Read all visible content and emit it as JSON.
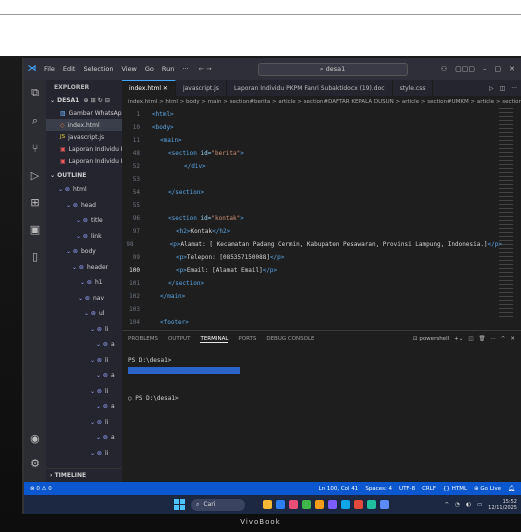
{
  "titlebar": {
    "menus": [
      "File",
      "Edit",
      "Selection",
      "View",
      "Go",
      "Run",
      "···"
    ],
    "nav": "← →",
    "search": "desa1"
  },
  "sidebar": {
    "header": "EXPLORER",
    "folder": "DESA1",
    "files": [
      {
        "name": "Gambar WhatsApp 2...",
        "type": "img"
      },
      {
        "name": "index.html",
        "type": "html"
      },
      {
        "name": "javascript.js",
        "type": "js"
      },
      {
        "name": "Laporan Individu PKP...",
        "type": "pdf"
      },
      {
        "name": "Laporan Individu PKP...",
        "type": "pdf"
      }
    ],
    "outline_label": "OUTLINE",
    "outline": [
      {
        "label": "html",
        "indent": 12
      },
      {
        "label": "head",
        "indent": 20
      },
      {
        "label": "title",
        "indent": 30
      },
      {
        "label": "link",
        "indent": 30
      },
      {
        "label": "body",
        "indent": 20
      },
      {
        "label": "header",
        "indent": 26
      },
      {
        "label": "h1",
        "indent": 34
      },
      {
        "label": "nav",
        "indent": 32
      },
      {
        "label": "ul",
        "indent": 38
      },
      {
        "label": "li",
        "indent": 44
      },
      {
        "label": "a",
        "indent": 50
      },
      {
        "label": "li",
        "indent": 44
      },
      {
        "label": "a",
        "indent": 50
      },
      {
        "label": "li",
        "indent": 44
      },
      {
        "label": "a",
        "indent": 50
      },
      {
        "label": "li",
        "indent": 44
      },
      {
        "label": "a",
        "indent": 50
      },
      {
        "label": "li",
        "indent": 44
      }
    ],
    "timeline_label": "TIMELINE"
  },
  "tabs": [
    {
      "label": "index.html ✕",
      "active": true
    },
    {
      "label": "javascript.js",
      "active": false
    },
    {
      "label": "Laporan Individu PKPM Fanri Subaktidocx (19).doc",
      "active": false
    },
    {
      "label": "style.css",
      "active": false
    }
  ],
  "breadcrumb": "index.html > html > body > main > section#berita > article > section#DAFTAR KEPALA DUSUN > article > section#UMKM > article > section#ko",
  "code_lines": [
    {
      "n": "1",
      "indent": 0,
      "parts": [
        {
          "c": "tag",
          "t": "<html>"
        }
      ]
    },
    {
      "n": "10",
      "indent": 0,
      "parts": [
        {
          "c": "tag",
          "t": "<body>"
        }
      ]
    },
    {
      "n": "11",
      "indent": 2,
      "parts": [
        {
          "c": "tag",
          "t": "<main>"
        }
      ]
    },
    {
      "n": "48",
      "indent": 4,
      "parts": [
        {
          "c": "tag",
          "t": "<section "
        },
        {
          "c": "attr",
          "t": "id="
        },
        {
          "c": "str",
          "t": "\"berita\""
        },
        {
          "c": "tag",
          "t": ">"
        }
      ]
    },
    {
      "n": "52",
      "indent": 8,
      "parts": [
        {
          "c": "tag",
          "t": "</div>"
        }
      ]
    },
    {
      "n": "53",
      "indent": 0,
      "parts": []
    },
    {
      "n": "54",
      "indent": 4,
      "parts": [
        {
          "c": "tag",
          "t": "</section>"
        }
      ]
    },
    {
      "n": "55",
      "indent": 0,
      "parts": []
    },
    {
      "n": "96",
      "indent": 4,
      "parts": [
        {
          "c": "tag",
          "t": "<section "
        },
        {
          "c": "attr",
          "t": "id="
        },
        {
          "c": "str",
          "t": "\"kontak\""
        },
        {
          "c": "tag",
          "t": ">"
        }
      ]
    },
    {
      "n": "97",
      "indent": 6,
      "parts": [
        {
          "c": "tag",
          "t": "<h2>"
        },
        {
          "c": "tx",
          "t": "Kontak"
        },
        {
          "c": "tag",
          "t": "</h2>"
        }
      ]
    },
    {
      "n": "98",
      "indent": 6,
      "parts": [
        {
          "c": "tag",
          "t": "<p>"
        },
        {
          "c": "tx",
          "t": "Alamat: [ Kecamatan Padang Cermin, Kabupaten Pesawaran, Provinsi Lampung, Indonesia.]"
        },
        {
          "c": "tag",
          "t": "</p>"
        }
      ]
    },
    {
      "n": "99",
      "indent": 6,
      "parts": [
        {
          "c": "tag",
          "t": "<p>"
        },
        {
          "c": "tx",
          "t": "Telepon: [085357150088]"
        },
        {
          "c": "tag",
          "t": "</p>"
        }
      ]
    },
    {
      "n": "100",
      "indent": 6,
      "parts": [
        {
          "c": "tag",
          "t": "<p>"
        },
        {
          "c": "tx",
          "t": "Email: [Alamat Email]"
        },
        {
          "c": "tag",
          "t": "</p>"
        }
      ]
    },
    {
      "n": "101",
      "indent": 4,
      "parts": [
        {
          "c": "tag",
          "t": "</section>"
        }
      ]
    },
    {
      "n": "102",
      "indent": 2,
      "parts": [
        {
          "c": "tag",
          "t": "</main>"
        }
      ]
    },
    {
      "n": "103",
      "indent": 0,
      "parts": []
    },
    {
      "n": "104",
      "indent": 2,
      "parts": [
        {
          "c": "tag",
          "t": "<footer>"
        }
      ]
    }
  ],
  "current_line": "100",
  "panel": {
    "tabs": [
      "PROBLEMS",
      "OUTPUT",
      "TERMINAL",
      "PORTS",
      "DEBUG CONSOLE"
    ],
    "active_tab": "TERMINAL",
    "shell": "powershell",
    "prompt1": "PS D:\\desa1>",
    "selected": "xxxxxxxxxxxxxxxxxxxxxxxxxxxxxx",
    "prompt2": "PS D:\\desa1>"
  },
  "statusbar": {
    "left": "⊗ 0 ⚠ 0",
    "position": "Ln 100, Col 41",
    "spaces": "Spaces: 4",
    "encoding": "UTF-8",
    "eol": "CRLF",
    "language": "{} HTML",
    "golive": "⊕ Go Live"
  },
  "taskbar": {
    "search": "Cari",
    "time": "15:52",
    "date": "12/11/2025",
    "icon_colors": [
      "#f2b735",
      "#2d7ff9",
      "#e94e77",
      "#3fb54a",
      "#f59c1a",
      "#7a5cff",
      "#0fa6e9",
      "#e24a3b",
      "#20c0a0",
      "#5a8cff"
    ]
  },
  "brand": "VivoBook"
}
